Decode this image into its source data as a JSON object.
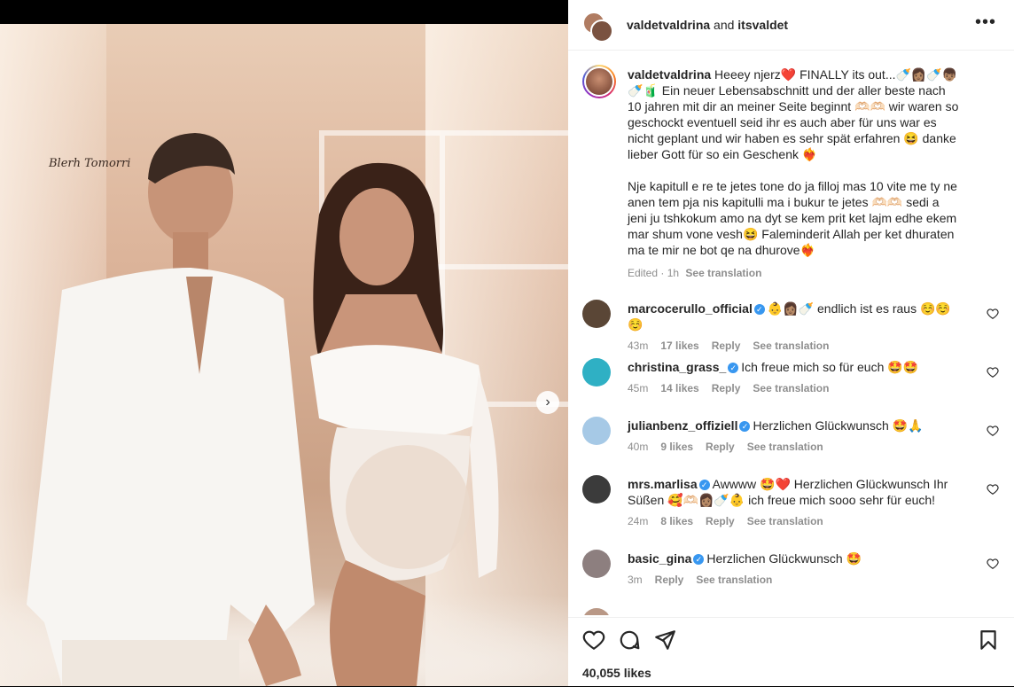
{
  "header": {
    "user1": "valdetvaldrina",
    "conj": " and ",
    "user2": "itsvaldet",
    "more_icon": "more-horizontal-icon"
  },
  "photo": {
    "signature": "Blerh Tomorri"
  },
  "caption": {
    "username": "valdetvaldrina",
    "text_de": " Heeey njerz❤️ FINALLY its out...🍼👩🏽🍼👦🏽🍼🧃 Ein neuer Lebensabschnitt und der aller beste nach 10 jahren mit dir an meiner Seite beginnt 🫶🏻🫶🏻 wir waren so geschockt eventuell seid ihr es auch aber für uns war es nicht geplant und wir haben es sehr spät erfahren 😆 danke lieber Gott für so ein Geschenk ❤️‍🔥",
    "text_al": "Nje kapitull e re te jetes tone do ja filloj mas 10 vite me ty ne anen tem pja nis kapitulli ma i bukur te jetes 🫶🏻🫶🏻 sedi a jeni ju tshkokum amo na dyt se kem prit ket lajm edhe ekem mar shum vone vesh😆 Faleminderit Allah per ket dhuraten ma te mir ne bot qe na dhurove❤️‍🔥",
    "edited": "Edited · 1h",
    "see_translation": "See translation"
  },
  "comments": [
    {
      "username": "marcocerullo_official",
      "text": "👶👩🏽🍼 endlich ist es raus ☺️☺️☺️",
      "time": "43m",
      "likes": "17 likes",
      "reply": "Reply",
      "translate": "See translation",
      "avatar_color": "#5a4636"
    },
    {
      "username": "christina_grass_",
      "text": "Ich freue mich so für euch 🤩🤩",
      "time": "45m",
      "likes": "14 likes",
      "reply": "Reply",
      "translate": "See translation",
      "avatar_color": "#2fb0c4"
    },
    {
      "username": "julianbenz_offiziell",
      "text": "Herzlichen Glückwunsch 🤩🙏",
      "time": "40m",
      "likes": "9 likes",
      "reply": "Reply",
      "translate": "See translation",
      "avatar_color": "#a6c9e6"
    },
    {
      "username": "mrs.marlisa",
      "line1": "Awwww 🤩❤️ Herzlichen Glückwunsch Ihr",
      "line2": "Süßen 🥰🫶🏻👩🏽🍼👶 ich freue mich sooo sehr für euch!",
      "time": "24m",
      "likes": "8 likes",
      "reply": "Reply",
      "translate": "See translation",
      "avatar_color": "#3b3b3b"
    },
    {
      "username": "basic_gina",
      "text": "Herzlichen Glückwunsch 🤩",
      "time": "3m",
      "reply": "Reply",
      "translate": "See translation",
      "avatar_color": "#8d7f7f"
    }
  ],
  "actions": {
    "like_icon": "heart-icon",
    "comment_icon": "comment-icon",
    "share_icon": "send-icon",
    "save_icon": "bookmark-icon",
    "likes": "40,055 likes"
  }
}
